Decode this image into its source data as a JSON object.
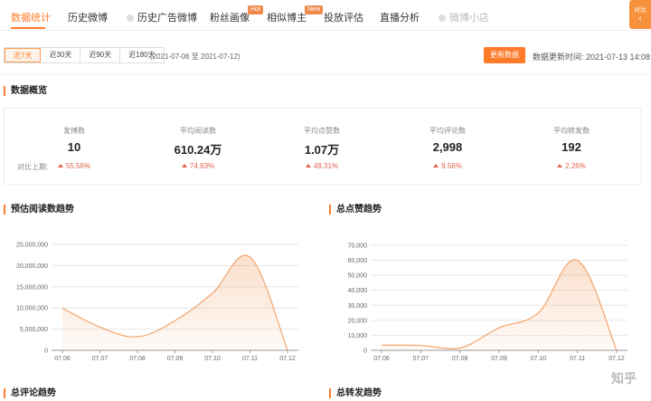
{
  "nav": {
    "items": [
      {
        "label": "数据统计",
        "active": true
      },
      {
        "label": "历史微博"
      },
      {
        "label": "历史广告微博",
        "icon": "circle-icon"
      },
      {
        "label": "粉丝画像",
        "tag": "Hot"
      },
      {
        "label": "相似博主",
        "tag": "New"
      },
      {
        "label": "投放评估"
      },
      {
        "label": "直播分析"
      },
      {
        "label": "微博小店",
        "icon": "circle-icon",
        "disabled": true
      }
    ],
    "side_button": "对比"
  },
  "filters": {
    "periods": [
      "近7天",
      "近30天",
      "近90天",
      "近180天"
    ],
    "selected": "近7天",
    "date_range": "(2021-07-06 至 2021-07-12)",
    "update_button": "更新数据",
    "update_time": "数据更新时间: 2021-07-13 14:08"
  },
  "overview": {
    "title": "数据概览",
    "compare_label": "对比上期:",
    "stats": [
      {
        "label": "发博数",
        "value": "10",
        "change": "55.56%"
      },
      {
        "label": "平均阅读数",
        "value": "610.24万",
        "change": "74.93%"
      },
      {
        "label": "平均点赞数",
        "value": "1.07万",
        "change": "49.31%"
      },
      {
        "label": "平均评论数",
        "value": "2,998",
        "change": "9.56%"
      },
      {
        "label": "平均转发数",
        "value": "192",
        "change": "2.26%"
      }
    ]
  },
  "sections": {
    "read_trend": "预估阅读数趋势",
    "like_trend": "总点赞趋势",
    "comment_trend": "总评论趋势",
    "repost_trend": "总转发趋势"
  },
  "chart_data": [
    {
      "type": "area",
      "title": "预估阅读数趋势",
      "categories": [
        "07.06",
        "07.07",
        "07.08",
        "07.09",
        "07.10",
        "07.11",
        "07.12"
      ],
      "values": [
        10000000,
        5500000,
        3200000,
        7000000,
        13500000,
        22000000,
        0
      ],
      "yticks": [
        "0",
        "5,000,000",
        "10,000,000",
        "15,000,000",
        "20,000,000",
        "25,000,000"
      ],
      "ylim": [
        0,
        25000000
      ],
      "color": "#f2a46b"
    },
    {
      "type": "area",
      "title": "总点赞趋势",
      "categories": [
        "07.06",
        "07.07",
        "07.08",
        "07.09",
        "07.10",
        "07.11",
        "07.12"
      ],
      "values": [
        3500,
        3200,
        1500,
        15000,
        25000,
        60000,
        0
      ],
      "yticks": [
        "0",
        "10,000",
        "20,000",
        "30,000",
        "40,000",
        "50,000",
        "60,000",
        "70,000"
      ],
      "ylim": [
        0,
        70000
      ],
      "color": "#f2a46b"
    }
  ],
  "watermark": "知乎"
}
